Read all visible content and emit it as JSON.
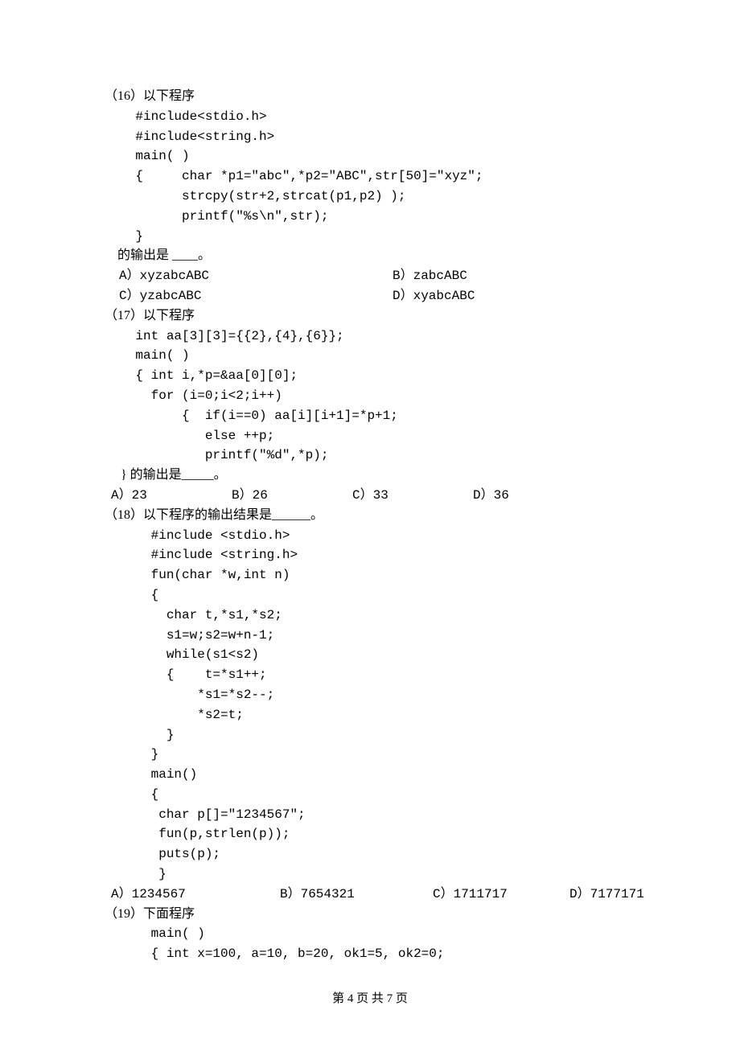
{
  "q16": {
    "num": "（16）",
    "intro": "以下程序",
    "code": [
      "    #include<stdio.h>",
      "    #include<string.h>",
      "    main( )",
      "    {     char *p1=\"abc\",*p2=\"ABC\",str[50]=\"xyz\";",
      "          strcpy(str+2,strcat(p1,p2) );",
      "          printf(\"%s\\n\",str);",
      "    }"
    ],
    "tail": "    的输出是 ____。",
    "opts": {
      "a": "A）xyzabcABC",
      "b": "B）zabcABC",
      "c": "C）yzabcABC",
      "d": "D）xyabcABC"
    }
  },
  "q17": {
    "num": "（17）",
    "intro": "以下程序",
    "code": [
      "    int aa[3][3]={{2},{4},{6}};",
      "    main( )",
      "    { int i,*p=&aa[0][0];",
      "      for (i=0;i<2;i++)",
      "          {  if(i==0) aa[i][i+1]=*p+1;",
      "             else ++p;",
      "             printf(\"%d\",*p);",
      "           }"
    ],
    "tail": "     } 的输出是_____。",
    "opts": {
      "a": "A）23",
      "b": "B）26",
      "c": "C）33",
      "d": "D）36"
    }
  },
  "q18": {
    "num": "（18）",
    "intro": "以下程序的输出结果是______。",
    "code": [
      "      #include <stdio.h>",
      "      #include <string.h>",
      "      fun(char *w,int n)",
      "      {",
      "        char t,*s1,*s2;",
      "        s1=w;s2=w+n-1;",
      "        while(s1<s2)",
      "        {    t=*s1++;",
      "            *s1=*s2--;",
      "            *s2=t;",
      "        }",
      "      }",
      "      main()",
      "      {",
      "       char p[]=\"1234567\";",
      "       fun(p,strlen(p));",
      "       puts(p);",
      "       }"
    ],
    "opts": {
      "a": "A）1234567",
      "b": "B）7654321",
      "c": "C）1711717",
      "d": "D）7177171"
    }
  },
  "q19": {
    "num": "（19）",
    "intro": "下面程序",
    "code": [
      "      main( )",
      "      { int x=100, a=10, b=20, ok1=5, ok2=0;"
    ]
  },
  "footer": "第 4 页 共 7 页"
}
